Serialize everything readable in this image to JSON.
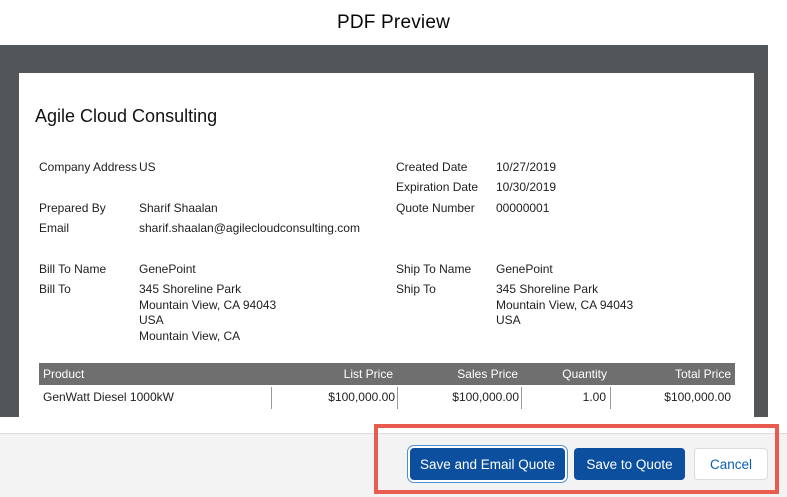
{
  "modal": {
    "title": "PDF Preview"
  },
  "quote": {
    "company_name": "Agile Cloud Consulting",
    "labels": {
      "company_address": "Company Address",
      "prepared_by": "Prepared By",
      "email": "Email",
      "bill_to_name": "Bill To Name",
      "bill_to": "Bill To",
      "created_date": "Created Date",
      "expiration_date": "Expiration Date",
      "quote_number": "Quote Number",
      "ship_to_name": "Ship To Name",
      "ship_to": "Ship To"
    },
    "values": {
      "company_address": "US",
      "prepared_by": "Sharif Shaalan",
      "email": "sharif.shaalan@agilecloudconsulting.com",
      "bill_to_name": "GenePoint",
      "bill_to": [
        "345 Shoreline Park",
        "Mountain View, CA 94043",
        "USA",
        "Mountain View, CA"
      ],
      "created_date": "10/27/2019",
      "expiration_date": "10/30/2019",
      "quote_number": "00000001",
      "ship_to_name": "GenePoint",
      "ship_to": [
        "345 Shoreline Park",
        "Mountain View, CA 94043",
        "USA"
      ]
    },
    "line_items": {
      "columns": [
        "Product",
        "List Price",
        "Sales Price",
        "Quantity",
        "Total Price"
      ],
      "rows": [
        [
          "GenWatt Diesel 1000kW",
          "$100,000.00",
          "$100,000.00",
          "1.00",
          "$100,000.00"
        ]
      ]
    }
  },
  "footer": {
    "save_email_label": "Save and Email Quote",
    "save_quote_label": "Save to Quote",
    "cancel_label": "Cancel"
  },
  "colors": {
    "primary": "#0b4f9e",
    "highlight": "#ea5b4f",
    "viewer_background": "#525659",
    "table_header": "#6f6f6f"
  }
}
